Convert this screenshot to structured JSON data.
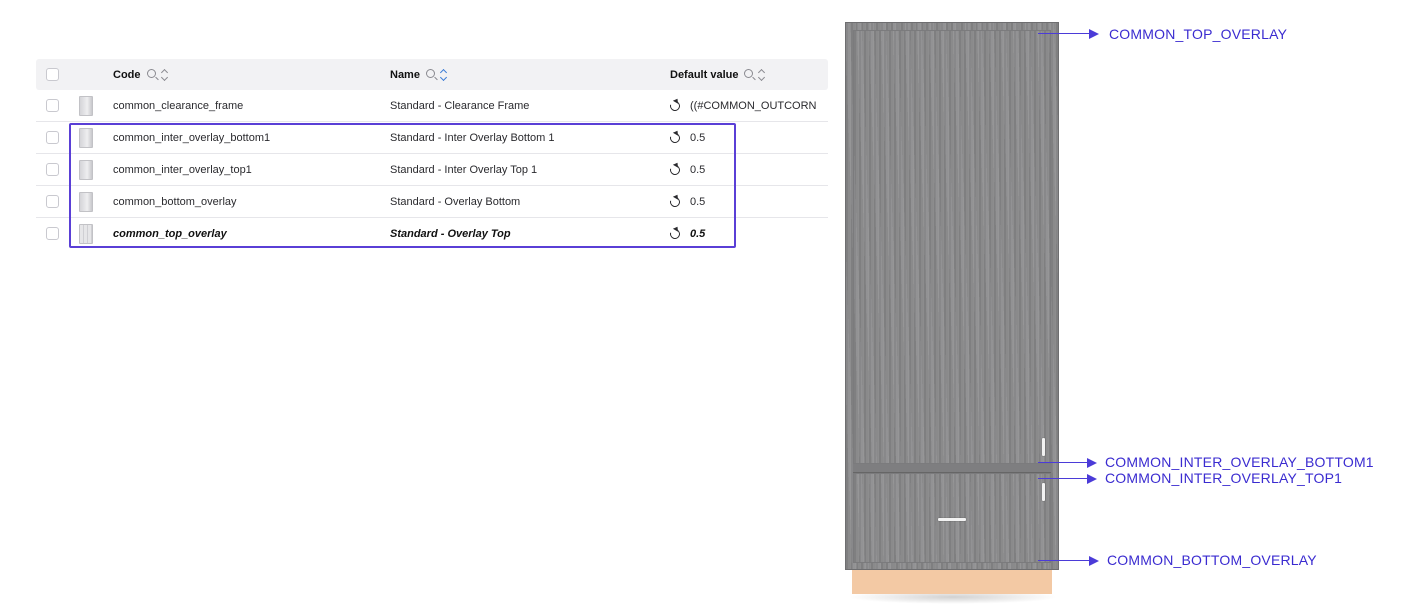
{
  "table": {
    "headers": {
      "code": "Code",
      "name": "Name",
      "default_value": "Default value"
    },
    "rows": [
      {
        "code": "common_clearance_frame",
        "name": "Standard - Clearance Frame",
        "default_value": "((#COMMON_OUTCORN",
        "thumb": "panel"
      },
      {
        "code": "common_inter_overlay_bottom1",
        "name": "Standard - Inter Overlay Bottom 1",
        "default_value": "0.5",
        "thumb": "panel"
      },
      {
        "code": "common_inter_overlay_top1",
        "name": "Standard - Inter Overlay Top 1",
        "default_value": "0.5",
        "thumb": "panel"
      },
      {
        "code": "common_bottom_overlay",
        "name": "Standard - Overlay Bottom",
        "default_value": "0.5",
        "thumb": "panel"
      },
      {
        "code": "common_top_overlay",
        "name": "Standard - Overlay Top",
        "default_value": "0.5",
        "thumb": "open-panel",
        "emphasized": true
      }
    ]
  },
  "callouts": {
    "top_overlay": "COMMON_TOP_OVERLAY",
    "inter_overlay_bottom1": "COMMON_INTER_OVERLAY_BOTTOM1",
    "inter_overlay_top1": "COMMON_INTER_OVERLAY_TOP1",
    "bottom_overlay": "COMMON_BOTTOM_OVERLAY"
  },
  "colors": {
    "highlight": "#5a3fd6",
    "callout": "#4b3bd8",
    "cabinet_wood": "#8b8b8d",
    "plinth": "#f3c9a4"
  }
}
